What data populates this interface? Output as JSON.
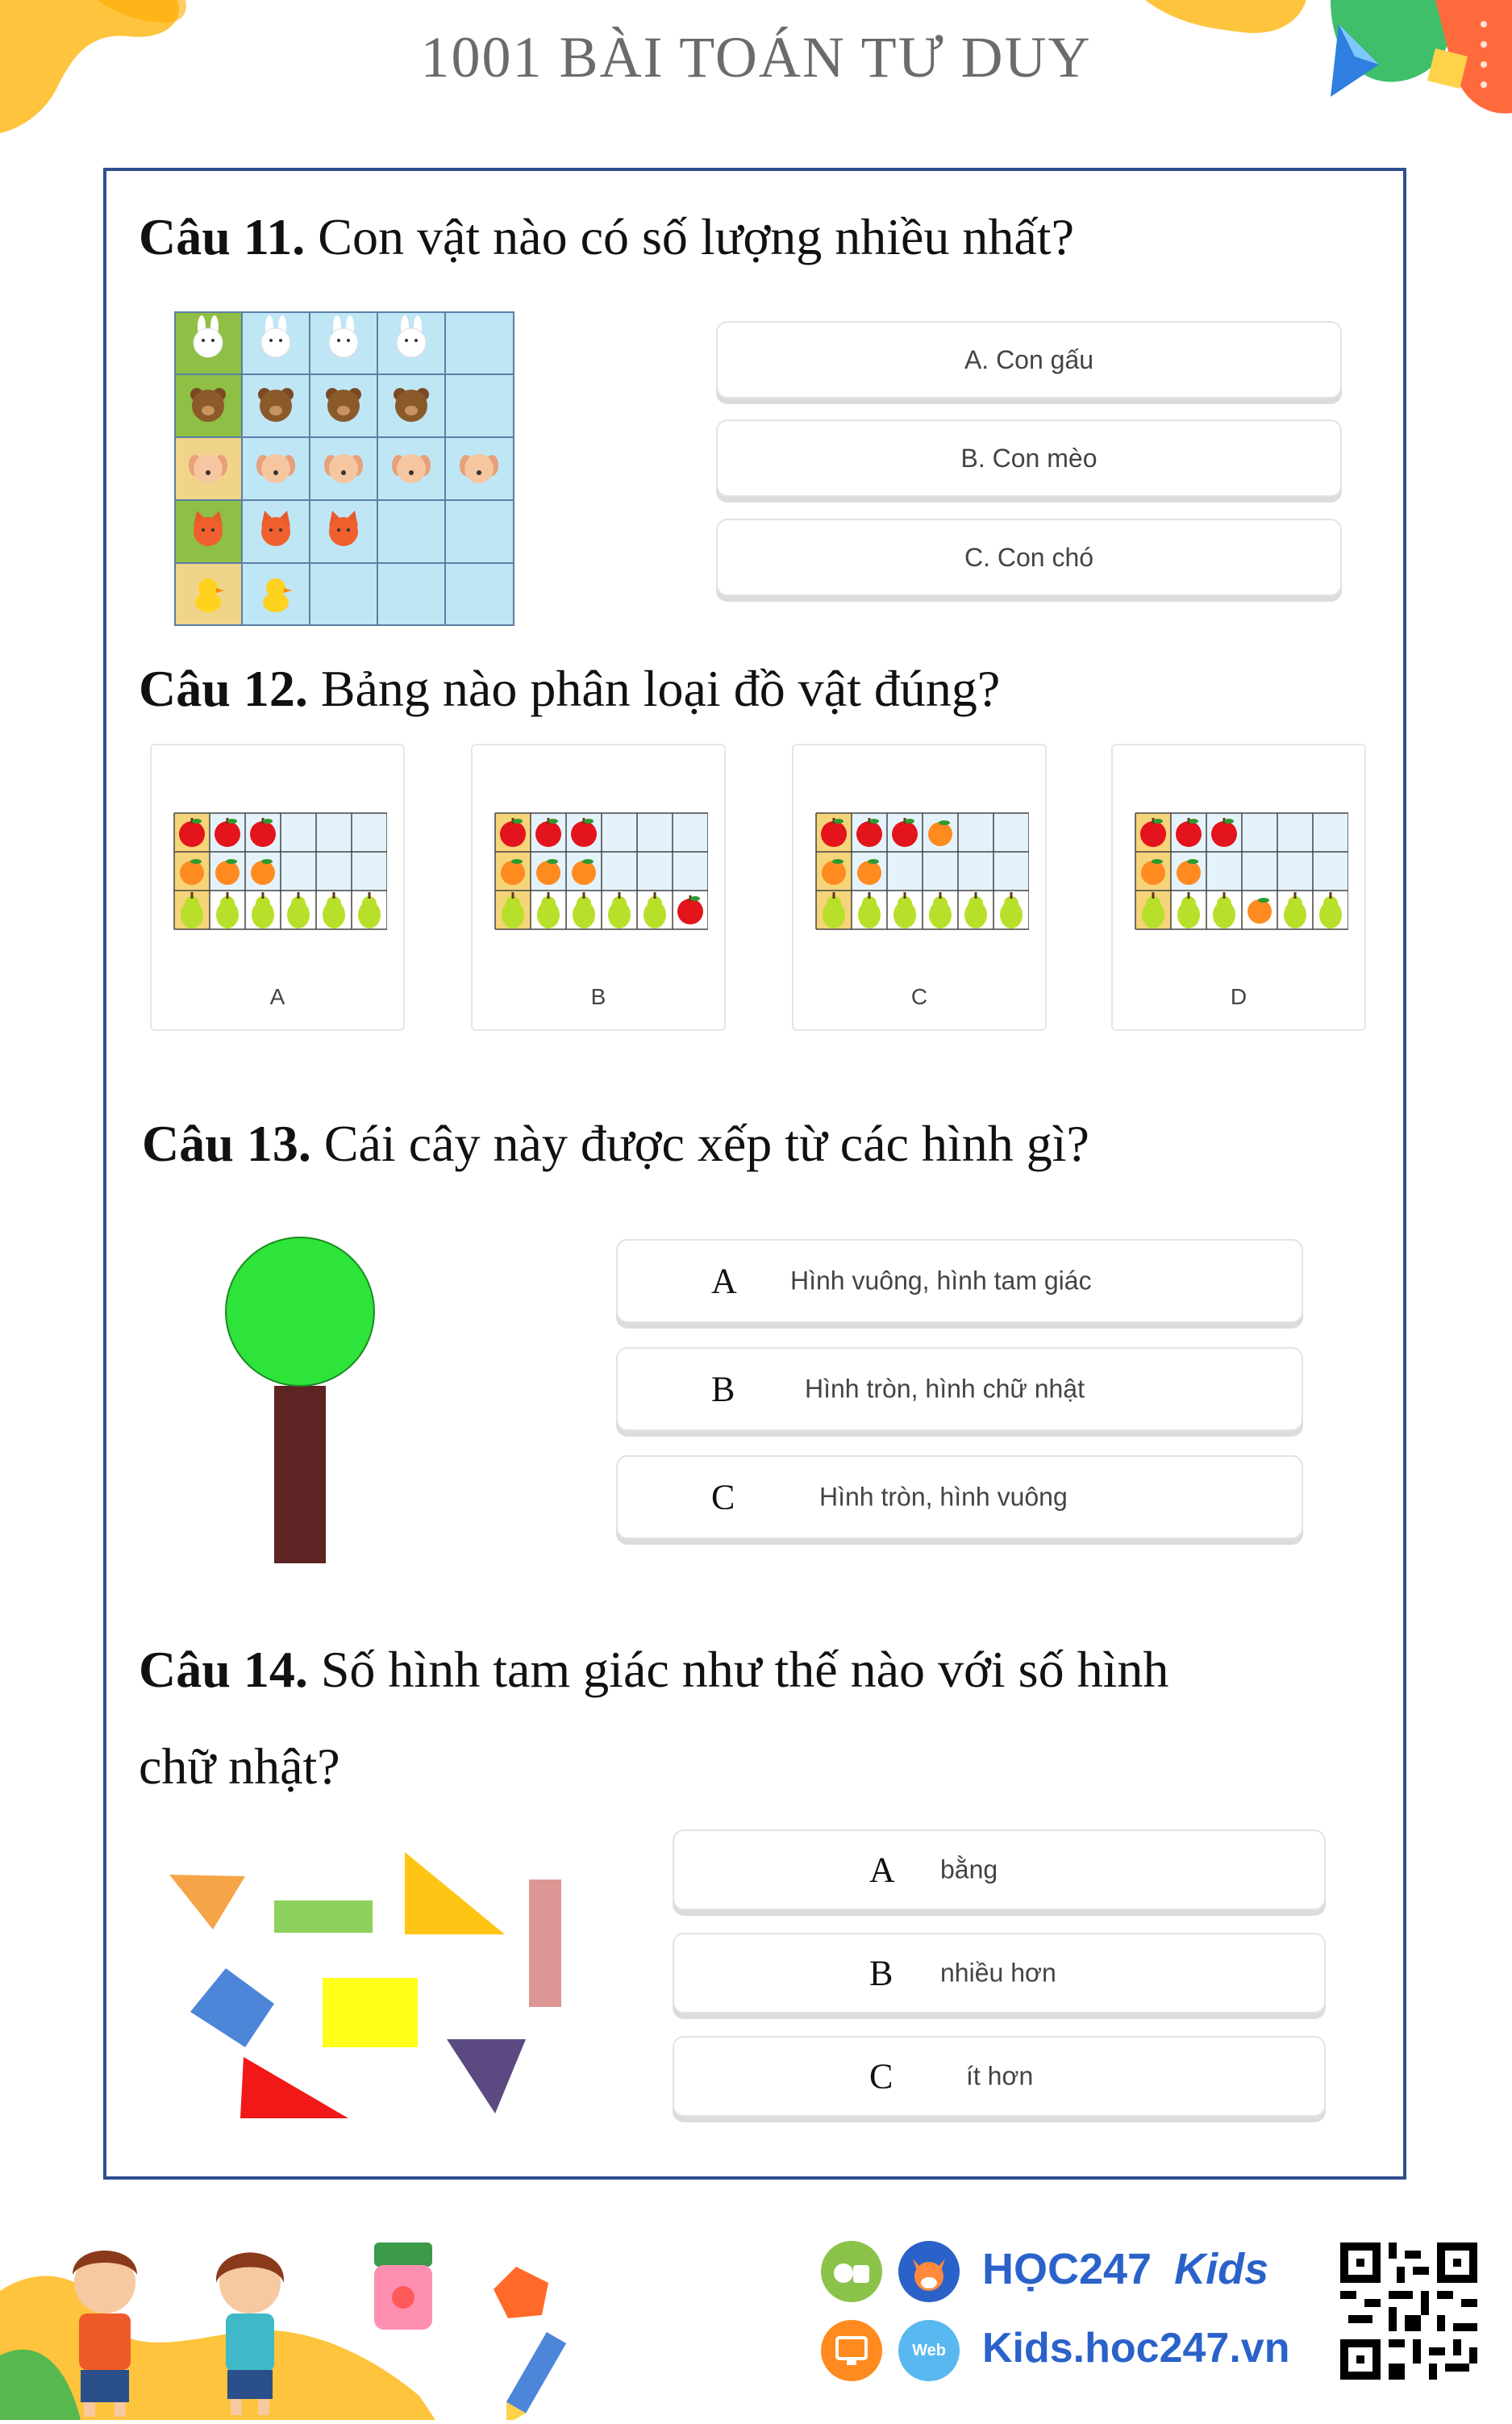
{
  "header": {
    "title": "1001 BÀI TOÁN TƯ DUY"
  },
  "q11": {
    "number": "Câu 11.",
    "text": " Con vật nào có số lượng nhiều nhất?",
    "grid_counts": {
      "rabbit": 4,
      "bear": 4,
      "dog": 5,
      "cat": 3,
      "duck": 2
    },
    "options": [
      "A. Con gấu",
      "B. Con mèo",
      "C. Con chó"
    ]
  },
  "q12": {
    "number": "Câu 12.",
    "text": " Bảng nào phân loại đồ vật đúng?",
    "cards": [
      {
        "label": "A",
        "rows": [
          [
            "apple",
            "apple",
            "apple"
          ],
          [
            "orange",
            "orange",
            "orange"
          ],
          [
            "pear",
            "pear",
            "pear",
            "pear",
            "pear",
            "pear"
          ]
        ]
      },
      {
        "label": "B",
        "rows": [
          [
            "apple",
            "apple",
            "apple"
          ],
          [
            "orange",
            "orange",
            "orange"
          ],
          [
            "pear",
            "pear",
            "pear",
            "pear",
            "pear",
            "apple"
          ]
        ]
      },
      {
        "label": "C",
        "rows": [
          [
            "apple",
            "apple",
            "apple",
            "orange"
          ],
          [
            "orange",
            "orange"
          ],
          [
            "pear",
            "pear",
            "pear",
            "pear",
            "pear",
            "pear"
          ]
        ]
      },
      {
        "label": "D",
        "rows": [
          [
            "apple",
            "apple",
            "apple"
          ],
          [
            "orange",
            "orange"
          ],
          [
            "pear",
            "pear",
            "pear",
            "orange",
            "pear",
            "pear"
          ]
        ]
      }
    ]
  },
  "q13": {
    "number": "Câu 13.",
    "text": " Cái cây này được xếp từ các hình gì?",
    "options": [
      {
        "letter": "A",
        "text": "Hình vuông, hình tam giác"
      },
      {
        "letter": "B",
        "text": "Hình tròn, hình chữ nhật"
      },
      {
        "letter": "C",
        "text": "Hình tròn, hình vuông"
      }
    ]
  },
  "q14": {
    "number": "Câu 14.",
    "text_line1": " Số hình tam giác như thế nào với số hình",
    "text_line2": "chữ nhật?",
    "options": [
      {
        "letter": "A",
        "text": "bằng"
      },
      {
        "letter": "B",
        "text": "nhiều hơn"
      },
      {
        "letter": "C",
        "text": "ít hơn"
      }
    ]
  },
  "footer": {
    "brand_hoc": "HỌC247",
    "brand_kids": "Kids",
    "site": "Kids.hoc247.vn",
    "web_badge": "Web"
  },
  "colors": {
    "frame": "#2f4f8f",
    "tree_crown": "#2ee33a",
    "tree_trunk": "#5e2424",
    "brand_blue": "#2a62c9"
  }
}
